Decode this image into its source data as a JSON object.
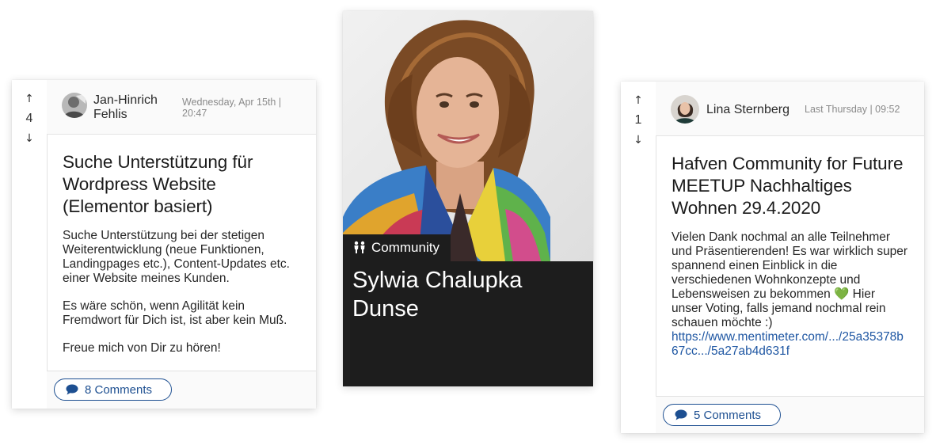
{
  "post1": {
    "votes": "4",
    "author": "Jan-Hinrich Fehlis",
    "date": "Wednesday, Apr 15th | 20:47",
    "title": "Suche Unterstützung für Wordpress Website (Elementor basiert)",
    "paragraphs": [
      "Suche Unterstützung bei der stetigen Weiterentwicklung (neue Funktionen, Landingpages etc.), Content-Updates etc. einer Website meines Kunden.",
      "Es wäre schön, wenn Agilität kein Fremdwort für Dich ist, ist aber kein Muß.",
      "Freue mich von Dir zu hören!"
    ],
    "comments": "8 Comments"
  },
  "profile": {
    "badge": "Community",
    "name": "Sylwia Chalupka Dunse"
  },
  "post2": {
    "votes": "1",
    "author": "Lina Sternberg",
    "date": "Last Thursday | 09:52",
    "title": "Hafven Community for Future MEETUP Nachhaltiges Wohnen 29.4.2020",
    "text": "Vielen Dank nochmal an alle Teilnehmer und Präsentierenden! Es war wirklich super spannend einen Einblick in die verschiedenen Wohnkonzepte und Lebensweisen zu bekommen 💚 Hier unser Voting, falls jemand nochmal rein schauen möchte :)",
    "link": "https://www.mentimeter.com/.../25a35378b67cc.../5a27ab4d631f",
    "comments": "5 Comments"
  },
  "icons": {
    "upvote": "arrow-up-icon",
    "downvote": "arrow-down-icon",
    "comment": "speech-bubble-icon",
    "community": "people-icon"
  },
  "colors": {
    "link": "#1f57a3",
    "button_border": "#1d4f91",
    "profile_background": "#1d1d1d",
    "heart": "#3cc23c"
  }
}
